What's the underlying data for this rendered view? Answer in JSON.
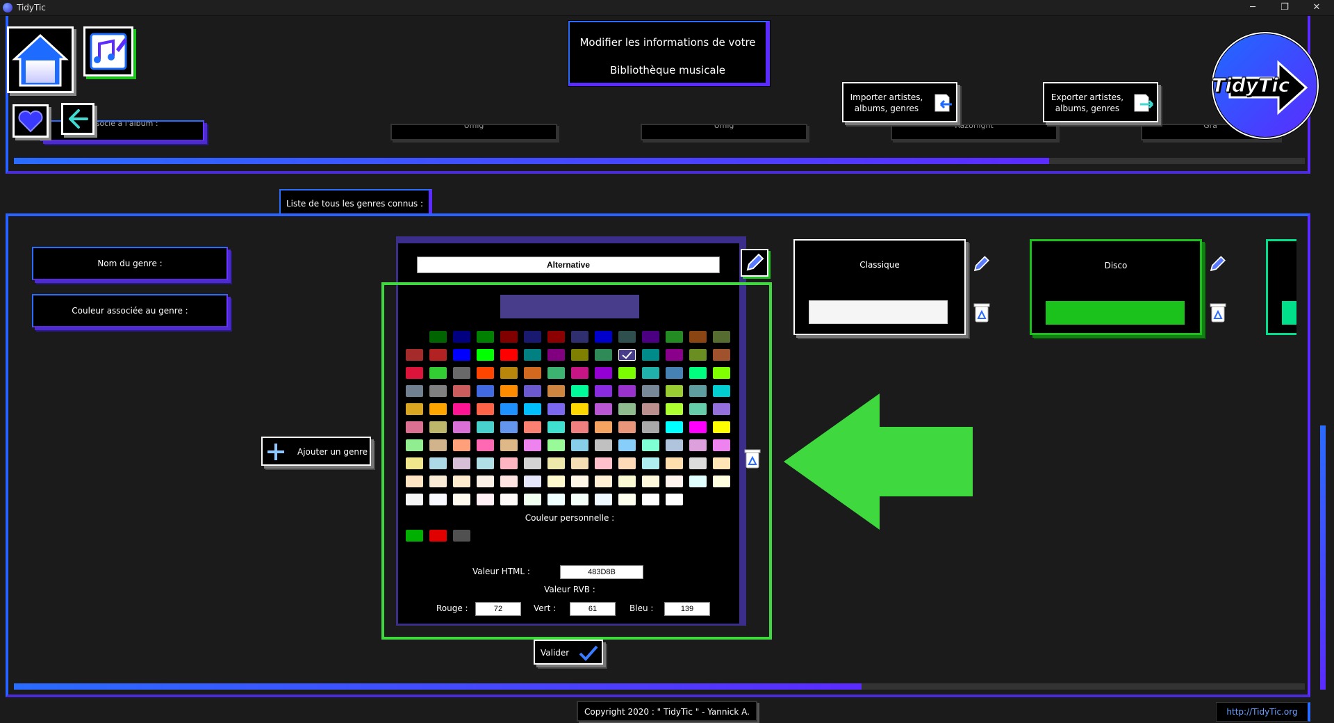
{
  "window": {
    "title": "TidyTic",
    "minimize": "─",
    "maximize": "❐",
    "close": "✕"
  },
  "header": {
    "title_line1": "Modifier les informations de votre",
    "title_line2": "Bibliothèque musicale",
    "import_label_line1": "Importer artistes,",
    "import_label_line2": "albums, genres",
    "export_label_line1": "Exporter artistes,",
    "export_label_line2": "albums, genres",
    "logo_text": "TidyTic"
  },
  "top_section": {
    "partial_cards": [
      "Associé à l'album :",
      "Umig",
      "Umig",
      "Razorlight",
      "Gra"
    ]
  },
  "genres_panel": {
    "tab_label": "Liste de tous les genres connus :",
    "name_label": "Nom du genre :",
    "color_label": "Couleur associée au genre :",
    "add_button": "Ajouter un genre",
    "validate_button": "Valider"
  },
  "editing_genre": {
    "name": "Alternative",
    "preview_color": "#483D8B",
    "custom_color_label": "Couleur personnelle :",
    "html_label": "Valeur HTML :",
    "html_value": "483D8B",
    "rgb_label": "Valeur RVB :",
    "red_label": "Rouge :",
    "red_value": "72",
    "green_label": "Vert :",
    "green_value": "61",
    "blue_label": "Bleu :",
    "blue_value": "139",
    "palette": [
      [
        "",
        "#006400",
        "#000080",
        "#008000",
        "#800000",
        "#191970",
        "#8B0000",
        "#2F2F70",
        "#0000CD",
        "#2F4F4F",
        "#4B0082",
        "#228B22",
        "#8B4513",
        "#556B2F"
      ],
      [
        "#A52A2A",
        "#B22222",
        "#0000FF",
        "#00FF00",
        "#FF0000",
        "#008080",
        "#800080",
        "#808000",
        "#2E8B57",
        "#483D8B",
        "#008B8B",
        "#8B008B",
        "#6B8E23",
        "#A0522D"
      ],
      [
        "#DC143C",
        "#32CD32",
        "#696969",
        "#FF4500",
        "#B8860B",
        "#D2691E",
        "#3CB371",
        "#C71585",
        "#9400D3",
        "#7CFC00",
        "#20B2AA",
        "#4682B4",
        "#00FF7F",
        "#7FFF00"
      ],
      [
        "#708090",
        "#808080",
        "#CD5C5C",
        "#4169E1",
        "#FF8C00",
        "#6A5ACD",
        "#CD853F",
        "#00FA9A",
        "#8A2BE2",
        "#9932CC",
        "#778899",
        "#9ACD32",
        "#5F9EA0",
        "#00CED1"
      ],
      [
        "#DAA520",
        "#FFA500",
        "#FF1493",
        "#FF6347",
        "#1E90FF",
        "#00BFFF",
        "#7B68EE",
        "#FFD700",
        "#BA55D3",
        "#8FBC8F",
        "#BC8F8F",
        "#ADFF2F",
        "#66CDAA",
        "#9370DB"
      ],
      [
        "#DB7093",
        "#BDB76B",
        "#DA70D6",
        "#48D1CC",
        "#6495ED",
        "#FA8072",
        "#40E0D0",
        "#F08080",
        "#F4A460",
        "#E9967A",
        "#A9A9A9",
        "#00FFFF",
        "#FF00FF",
        "#FFFF00"
      ],
      [
        "#90EE90",
        "#D2B48C",
        "#FFA07A",
        "#FF69B4",
        "#DEB887",
        "#EE82EE",
        "#98FB98",
        "#87CEEB",
        "#C0C0C0",
        "#87CEFA",
        "#7FFFD4",
        "#B0C4DE",
        "#DDA0DD",
        "#EE82EE"
      ],
      [
        "#F0E68C",
        "#ADD8E6",
        "#D8BFD8",
        "#B0E0E6",
        "#FFB6C1",
        "#D3D3D3",
        "#EEE8AA",
        "#F5DEB3",
        "#FFC0CB",
        "#FFDAB9",
        "#AFEEEE",
        "#FFDEAD",
        "#DCDCDC",
        "#FFE4B5"
      ],
      [
        "#FFE4C4",
        "#FAEBD7",
        "#FFEBCD",
        "#FAF0E6",
        "#FFE4E1",
        "#E6E6FA",
        "#FFFACD",
        "#FDF5E6",
        "#FFEFD5",
        "#FAFAD2",
        "#FFF8DC",
        "#FFF5EE",
        "#E0FFFF",
        "#FFFFE0"
      ],
      [
        "#F5F5F5",
        "#F8F8FF",
        "#FFFAF0",
        "#FFF0F5",
        "#FFFAFA",
        "#F0FFF0",
        "#F0FFFF",
        "#F5FFFA",
        "#F0F8FF",
        "#FFFFF0",
        "#FFFFFF",
        "#FFFFFF"
      ]
    ],
    "selected_color": "#483D8B",
    "custom_colors": [
      "#00B000",
      "#E00000",
      "#505050"
    ]
  },
  "genre_cards": [
    {
      "name": "Classique",
      "color": "#F5F5F5",
      "border": "#FFFFFF"
    },
    {
      "name": "Disco",
      "color": "#1CC21C",
      "border": "#1CC21C"
    },
    {
      "name": "",
      "color": "#00E08A",
      "border": "#00E08A"
    }
  ],
  "footer": {
    "copyright": "Copyright 2020 : \" TidyTic \" - Yannick A.",
    "link": "http://TidyTic.org"
  },
  "colors": {
    "accent_blue": "#2962FF",
    "accent_violet": "#5B2BFF",
    "highlight_green": "#3FD93F"
  }
}
